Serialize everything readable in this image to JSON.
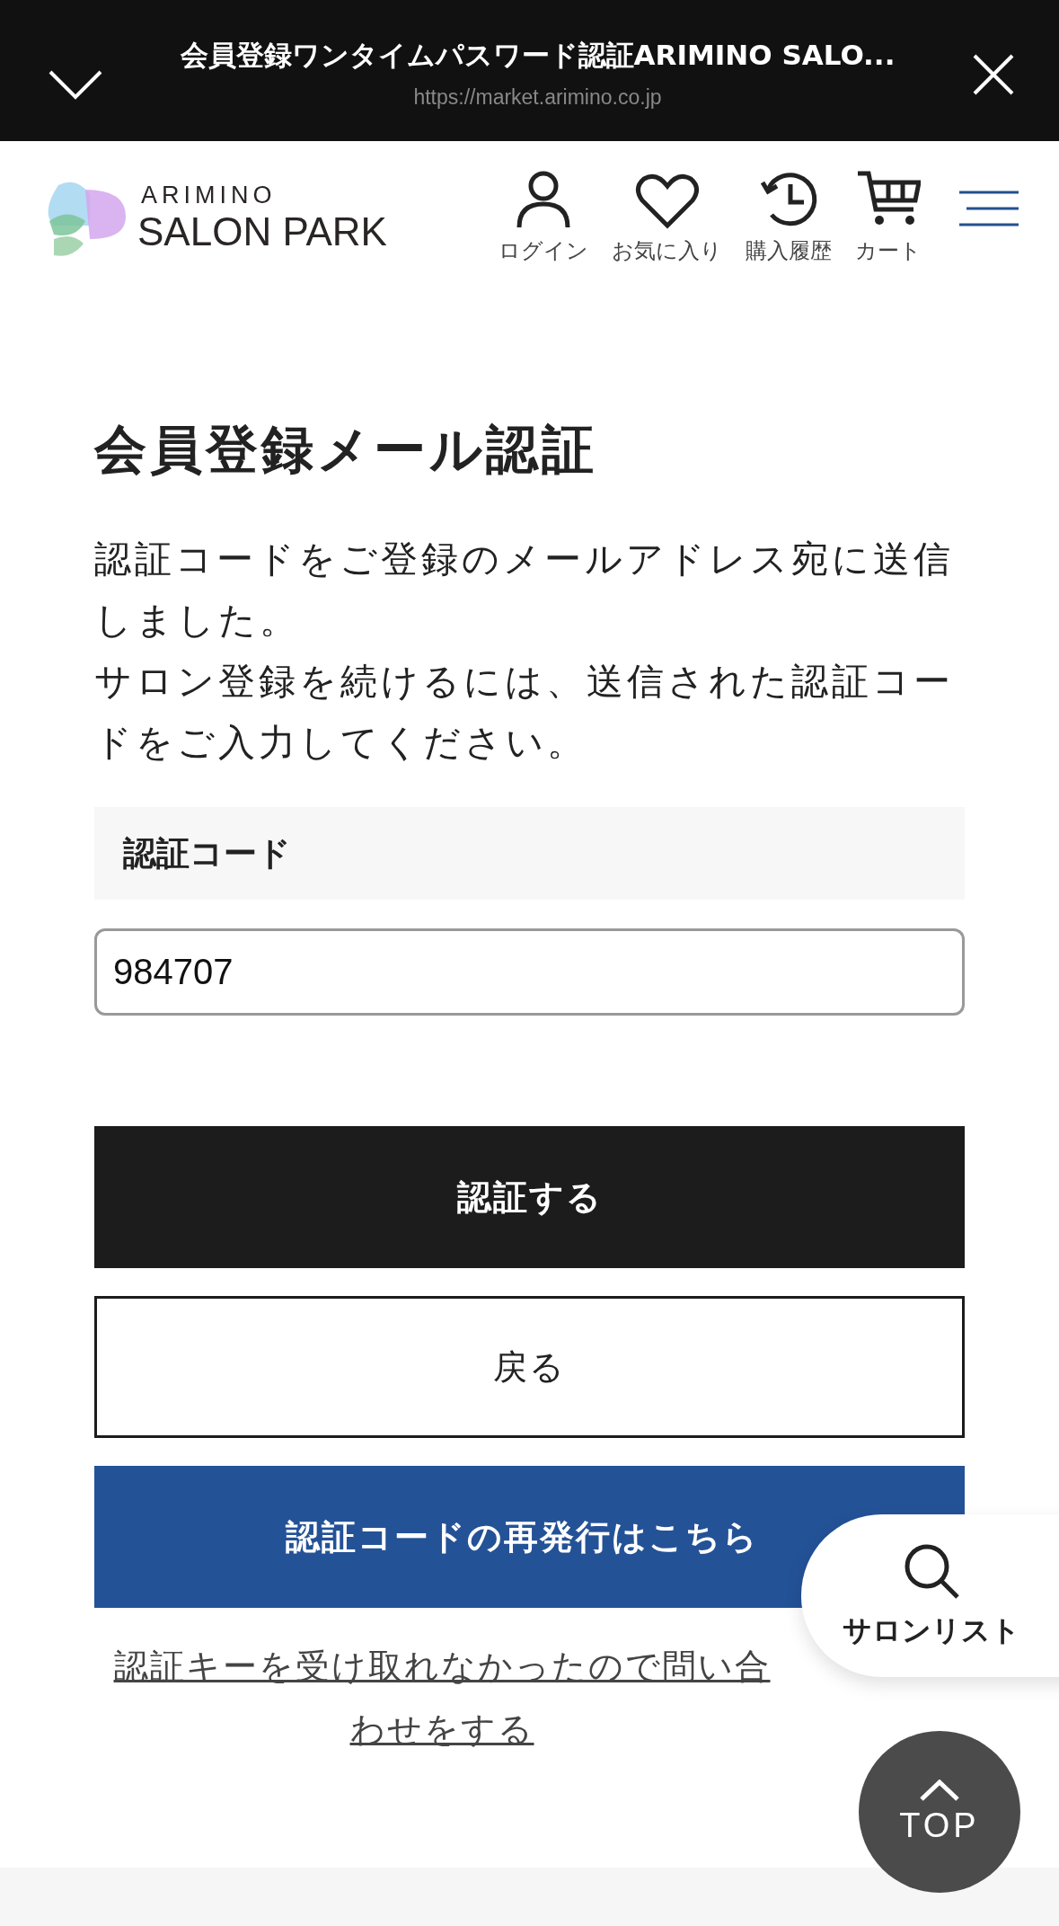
{
  "browser_bar": {
    "title": "会員登録ワンタイムパスワード認証ARIMINO SALO...",
    "url": "https://market.arimino.co.jp"
  },
  "header": {
    "logo_top": "ARIMINO",
    "logo_bottom": "SALON PARK",
    "nav": [
      {
        "kind": "user",
        "label": "ログイン"
      },
      {
        "kind": "heart",
        "label": "お気に入り"
      },
      {
        "kind": "history",
        "label": "購入履歴"
      },
      {
        "kind": "cart",
        "label": "カート"
      }
    ]
  },
  "page_title": "会員登録メール認証",
  "description": [
    "認証コードをご登録のメールアドレス宛に送信しました。",
    "サロン登録を続けるには、送信された認証コードをご入力してください。"
  ],
  "field": {
    "label": "認証コード",
    "value": "984707"
  },
  "buttons": [
    {
      "kind": "primary",
      "label": "認証する"
    },
    {
      "kind": "outline",
      "label": "戻る"
    },
    {
      "kind": "blue",
      "label": "認証コードの再発行はこちら"
    }
  ],
  "contact_link": "認証キーを受け取れなかったので問い合わせをする",
  "salon_list": {
    "label": "サロンリスト"
  },
  "top_button": {
    "label": "TOP"
  }
}
